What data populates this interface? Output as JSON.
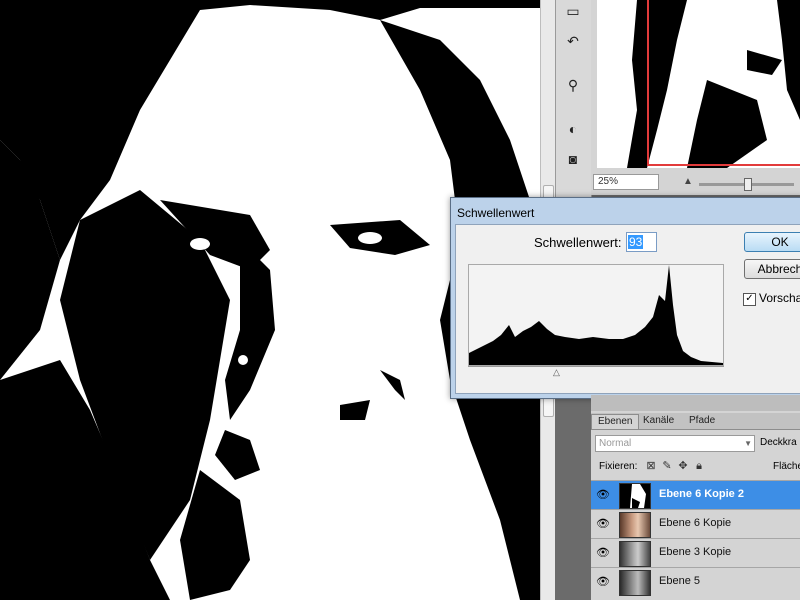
{
  "dialog": {
    "title": "Schwellenwert",
    "threshold_label": "Schwellenwert:",
    "threshold_value": "93",
    "ok_label": "OK",
    "cancel_label": "Abbrech",
    "preview_label": "Vorscha",
    "preview_checked": true
  },
  "navigator": {
    "zoom": "25%"
  },
  "layers_panel": {
    "tabs": [
      "Ebenen",
      "Kanäle",
      "Pfade"
    ],
    "blend_mode": "Normal",
    "opacity_label": "Deckkra",
    "lock_label": "Fixieren:",
    "fill_label": "Fläche",
    "layers": [
      {
        "name": "Ebene 6 Kopie 2",
        "selected": true
      },
      {
        "name": "Ebene 6 Kopie",
        "selected": false
      },
      {
        "name": "Ebene 3 Kopie",
        "selected": false
      },
      {
        "name": "Ebene 5",
        "selected": false
      }
    ]
  },
  "icons": {
    "eye": "eye-icon",
    "lock_transparent": "lock-transparent-icon",
    "lock_paint": "brush-icon",
    "lock_move": "move-icon",
    "lock_all": "lock-icon"
  },
  "colors": {
    "selection": "#3d8ee6",
    "proxy_border": "#e23b3b"
  }
}
